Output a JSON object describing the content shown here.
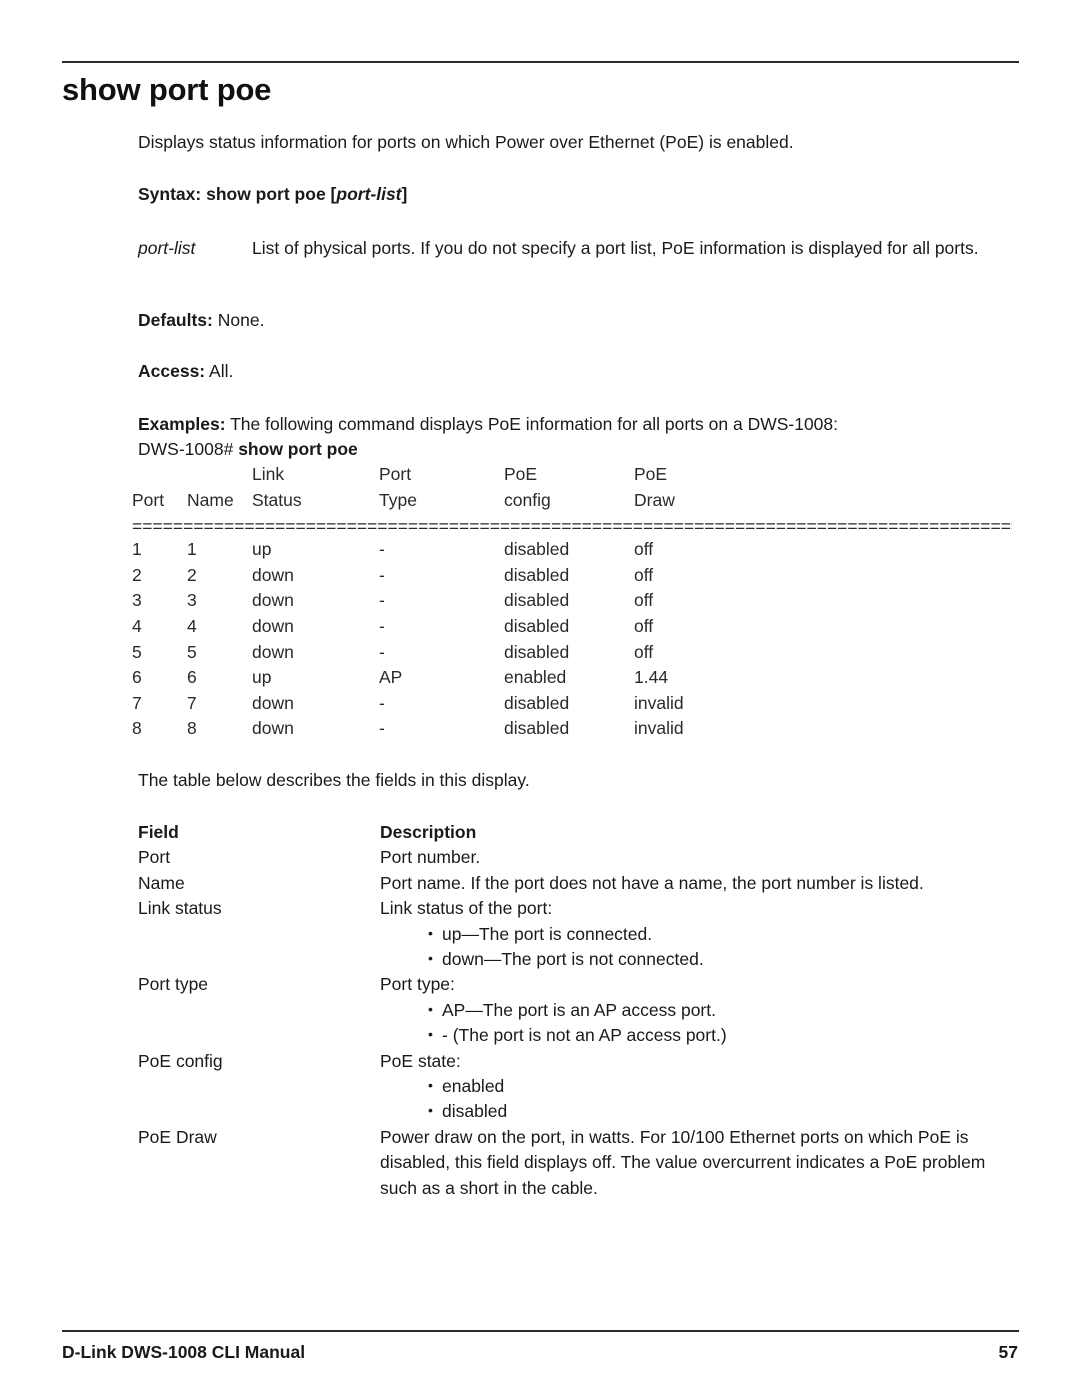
{
  "document": {
    "title": "show port poe",
    "intro": "Displays status information for ports on which Power over Ethernet (PoE) is enabled."
  },
  "syntax": {
    "label": "Syntax:",
    "command": "show port poe",
    "open_bracket": "[",
    "parameter": "port-list",
    "close_bracket": "]"
  },
  "parameter": {
    "term": "port-list",
    "definition": "List of physical ports. If you do not specify a port list, PoE information is displayed for all ports."
  },
  "defaults": {
    "label": "Defaults:",
    "value": "None."
  },
  "access": {
    "label": "Access:",
    "value": "All."
  },
  "examples": {
    "label": "Examples:",
    "text": "The following command displays PoE information for all ports on a DWS-1008:",
    "prompt": "DWS-1008#",
    "command": "show port poe"
  },
  "cli_output": {
    "header_line1": {
      "port": "",
      "name": "",
      "link": "Link",
      "type": "Port",
      "config": "PoE",
      "draw": "PoE"
    },
    "header_line2": {
      "port": "Port",
      "name": "Name",
      "link": "Status",
      "type": "Type",
      "config": "config",
      "draw": "Draw"
    },
    "separator": "================================================================",
    "rows": [
      {
        "port": "1",
        "name": "1",
        "link": "up",
        "type": "-",
        "config": "disabled",
        "draw": "off"
      },
      {
        "port": "2",
        "name": "2",
        "link": "down",
        "type": "-",
        "config": "disabled",
        "draw": "off"
      },
      {
        "port": "3",
        "name": "3",
        "link": "down",
        "type": "-",
        "config": "disabled",
        "draw": "off"
      },
      {
        "port": "4",
        "name": "4",
        "link": "down",
        "type": "-",
        "config": "disabled",
        "draw": "off"
      },
      {
        "port": "5",
        "name": "5",
        "link": "down",
        "type": "-",
        "config": "disabled",
        "draw": "off"
      },
      {
        "port": "6",
        "name": "6",
        "link": "up",
        "type": "AP",
        "config": "enabled",
        "draw": "1.44"
      },
      {
        "port": "7",
        "name": "7",
        "link": "down",
        "type": "-",
        "config": "disabled",
        "draw": "invalid"
      },
      {
        "port": "8",
        "name": "8",
        "link": "down",
        "type": "-",
        "config": "disabled",
        "draw": "invalid"
      }
    ]
  },
  "table_intro": "The table below describes the fields in this display.",
  "field_table": {
    "headers": {
      "field": "Field",
      "description": "Description"
    },
    "rows": [
      {
        "field": "Port",
        "description": "Port number.",
        "bullets": []
      },
      {
        "field": "Name",
        "description": "Port name. If the port does not have a name, the port number is listed.",
        "bullets": []
      },
      {
        "field": "Link status",
        "description": "Link status of the port:",
        "bullets": [
          "up—The port is connected.",
          "down—The port is not connected."
        ]
      },
      {
        "field": "Port type",
        "description": "Port type:",
        "bullets": [
          "AP—The port is an AP access port.",
          "- (The port is not an AP access port.)"
        ]
      },
      {
        "field": "PoE config",
        "description": "PoE state:",
        "bullets": [
          "enabled",
          "disabled"
        ]
      },
      {
        "field": "PoE Draw",
        "description": "Power draw on the port, in watts. For 10/100 Ethernet ports on which PoE is disabled, this field displays off. The value overcurrent indicates a PoE problem such as a short in the cable.",
        "bullets": []
      }
    ]
  },
  "footer": {
    "left": "D-Link DWS-1008 CLI Manual",
    "page_number": "57"
  }
}
